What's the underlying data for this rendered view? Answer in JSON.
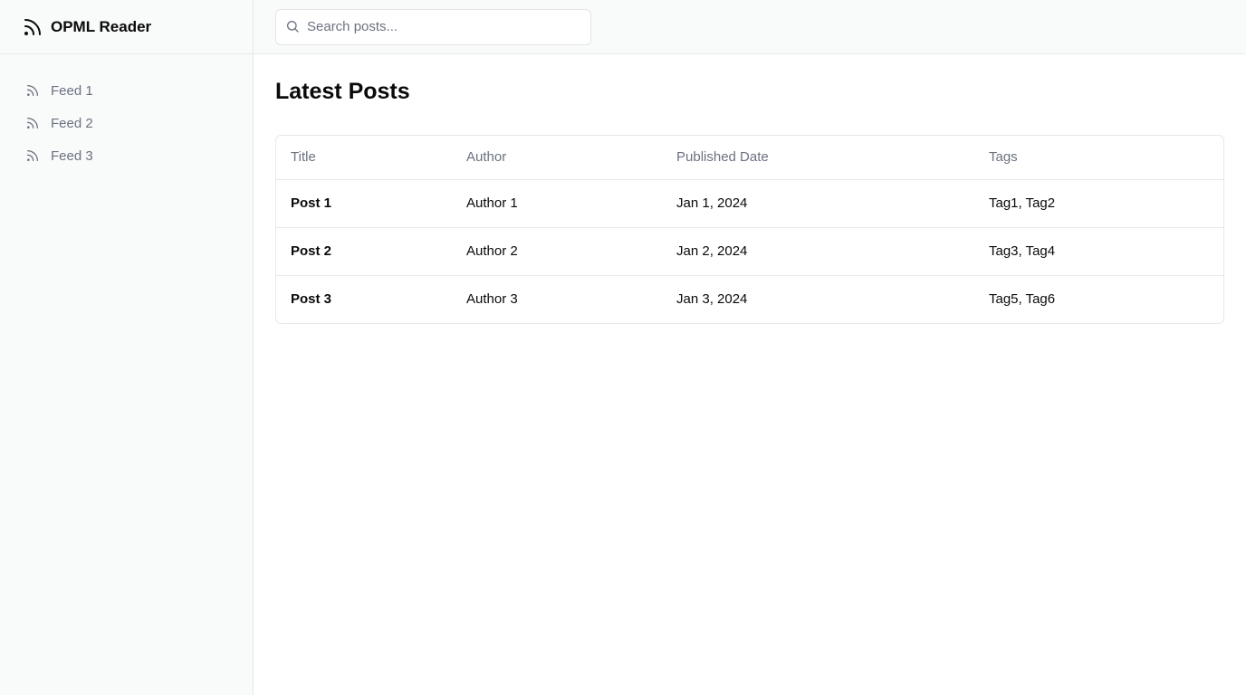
{
  "app": {
    "title": "OPML Reader",
    "icon": "rss-icon"
  },
  "sidebar": {
    "feeds": [
      {
        "label": "Feed 1",
        "icon": "rss-icon"
      },
      {
        "label": "Feed 2",
        "icon": "rss-icon"
      },
      {
        "label": "Feed 3",
        "icon": "rss-icon"
      }
    ]
  },
  "search": {
    "placeholder": "Search posts...",
    "value": "",
    "icon": "search-icon"
  },
  "main": {
    "heading": "Latest Posts",
    "table": {
      "columns": [
        "Title",
        "Author",
        "Published Date",
        "Tags"
      ],
      "rows": [
        {
          "title": "Post 1",
          "author": "Author 1",
          "date": "Jan 1, 2024",
          "tags": "Tag1, Tag2"
        },
        {
          "title": "Post 2",
          "author": "Author 2",
          "date": "Jan 2, 2024",
          "tags": "Tag3, Tag4"
        },
        {
          "title": "Post 3",
          "author": "Author 3",
          "date": "Jan 3, 2024",
          "tags": "Tag5, Tag6"
        }
      ]
    }
  },
  "colors": {
    "sidebar_bg": "#f9fafa",
    "border": "#e6e8ea",
    "muted_text": "#6b7280",
    "text": "#0a0a0a"
  }
}
